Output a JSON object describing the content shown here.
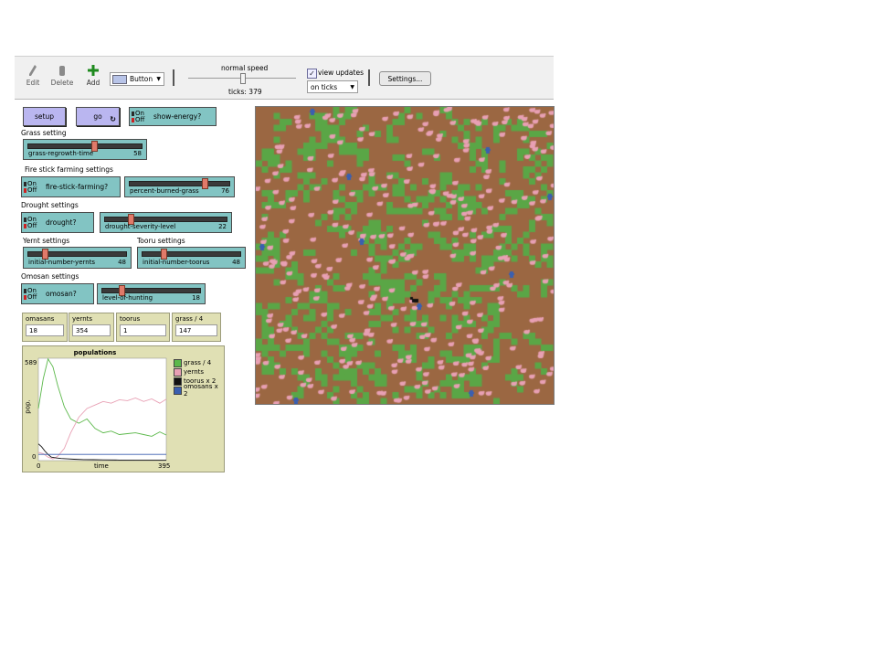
{
  "toolbar": {
    "edit_label": "Edit",
    "delete_label": "Delete",
    "add_label": "Add",
    "widget_type": "Button",
    "speed_label": "normal speed",
    "ticks_label": "ticks: 379",
    "view_updates_label": "view updates",
    "view_updates_checked": true,
    "update_mode": "on ticks",
    "settings_label": "Settings..."
  },
  "buttons": {
    "setup": "setup",
    "go": "go"
  },
  "switches": {
    "show_energy": {
      "label": "show-energy?",
      "state": "Off"
    },
    "fire_stick": {
      "label": "fire-stick-farming?",
      "state": "Off"
    },
    "drought": {
      "label": "drought?",
      "state": "Off"
    },
    "omosan": {
      "label": "omosan?",
      "state": "Off"
    },
    "on_text": "On",
    "off_text": "Off"
  },
  "sections": {
    "grass": "Grass setting",
    "fire": "Fire stick farming settings",
    "drought": "Drought settings",
    "yernt": "Yernt settings",
    "tooru": "Tooru settings",
    "omosan": "Omosan settings"
  },
  "sliders": {
    "grass_regrowth": {
      "label": "grass-regrowth-time",
      "value": "58",
      "fraction": 0.58
    },
    "percent_burned": {
      "label": "percent-burned-grass",
      "value": "76",
      "fraction": 0.76
    },
    "drought_severity": {
      "label": "drought-severity-level",
      "value": "22",
      "fraction": 0.2
    },
    "initial_yernts": {
      "label": "initial-number-yernts",
      "value": "48",
      "fraction": 0.16
    },
    "initial_toorus": {
      "label": "initial-number-toorus",
      "value": "48",
      "fraction": 0.2
    },
    "hunting": {
      "label": "level-of-hunting",
      "value": "18",
      "fraction": 0.18
    }
  },
  "monitors": [
    {
      "label": "omasans",
      "value": "18"
    },
    {
      "label": "yernts",
      "value": "354"
    },
    {
      "label": "toorus",
      "value": "1"
    },
    {
      "label": "grass / 4",
      "value": "147"
    }
  ],
  "plot": {
    "title": "populations",
    "ylabel": "pop.",
    "xlabel": "time",
    "y_max_label": "589",
    "y_min_label": "0",
    "x_min_label": "0",
    "x_max_label": "395",
    "legend": [
      {
        "name": "grass / 4",
        "color": "#5bb84a"
      },
      {
        "name": "yernts",
        "color": "#e8a0b4"
      },
      {
        "name": "toorus x 2",
        "color": "#111111"
      },
      {
        "name": "omosans x 2",
        "color": "#3a5fb0"
      }
    ]
  },
  "chart_data": {
    "type": "line",
    "title": "populations",
    "xlabel": "time",
    "ylabel": "pop.",
    "xlim": [
      0,
      395
    ],
    "ylim": [
      0,
      589
    ],
    "series": [
      {
        "name": "grass / 4",
        "color": "#5bb84a",
        "x": [
          0,
          15,
          30,
          45,
          60,
          80,
          100,
          125,
          150,
          175,
          200,
          225,
          250,
          275,
          300,
          325,
          350,
          375,
          395
        ],
        "y": [
          300,
          470,
          585,
          540,
          430,
          310,
          240,
          215,
          240,
          185,
          160,
          170,
          150,
          155,
          160,
          150,
          140,
          165,
          147
        ]
      },
      {
        "name": "yernts",
        "color": "#e8a0b4",
        "x": [
          0,
          15,
          30,
          45,
          60,
          80,
          100,
          125,
          150,
          175,
          200,
          225,
          250,
          275,
          300,
          325,
          350,
          375,
          395
        ],
        "y": [
          48,
          40,
          20,
          10,
          25,
          70,
          160,
          250,
          300,
          320,
          340,
          330,
          350,
          345,
          360,
          340,
          355,
          330,
          354
        ]
      },
      {
        "name": "toorus x 2",
        "color": "#111111",
        "x": [
          0,
          10,
          20,
          30,
          40,
          55,
          70,
          90,
          110,
          140,
          170,
          200,
          250,
          300,
          350,
          395
        ],
        "y": [
          96,
          80,
          55,
          35,
          20,
          15,
          12,
          10,
          8,
          6,
          5,
          4,
          3,
          2,
          2,
          2
        ]
      },
      {
        "name": "omosans x 2",
        "color": "#3a5fb0",
        "x": [
          0,
          395
        ],
        "y": [
          36,
          36
        ]
      }
    ]
  },
  "view": {
    "grass_color": "#5aa646",
    "soil_color": "#9b6742",
    "yernt_color": "#e8a0b4",
    "omosan_color": "#3a5fb0",
    "tooru_color": "#111111"
  }
}
